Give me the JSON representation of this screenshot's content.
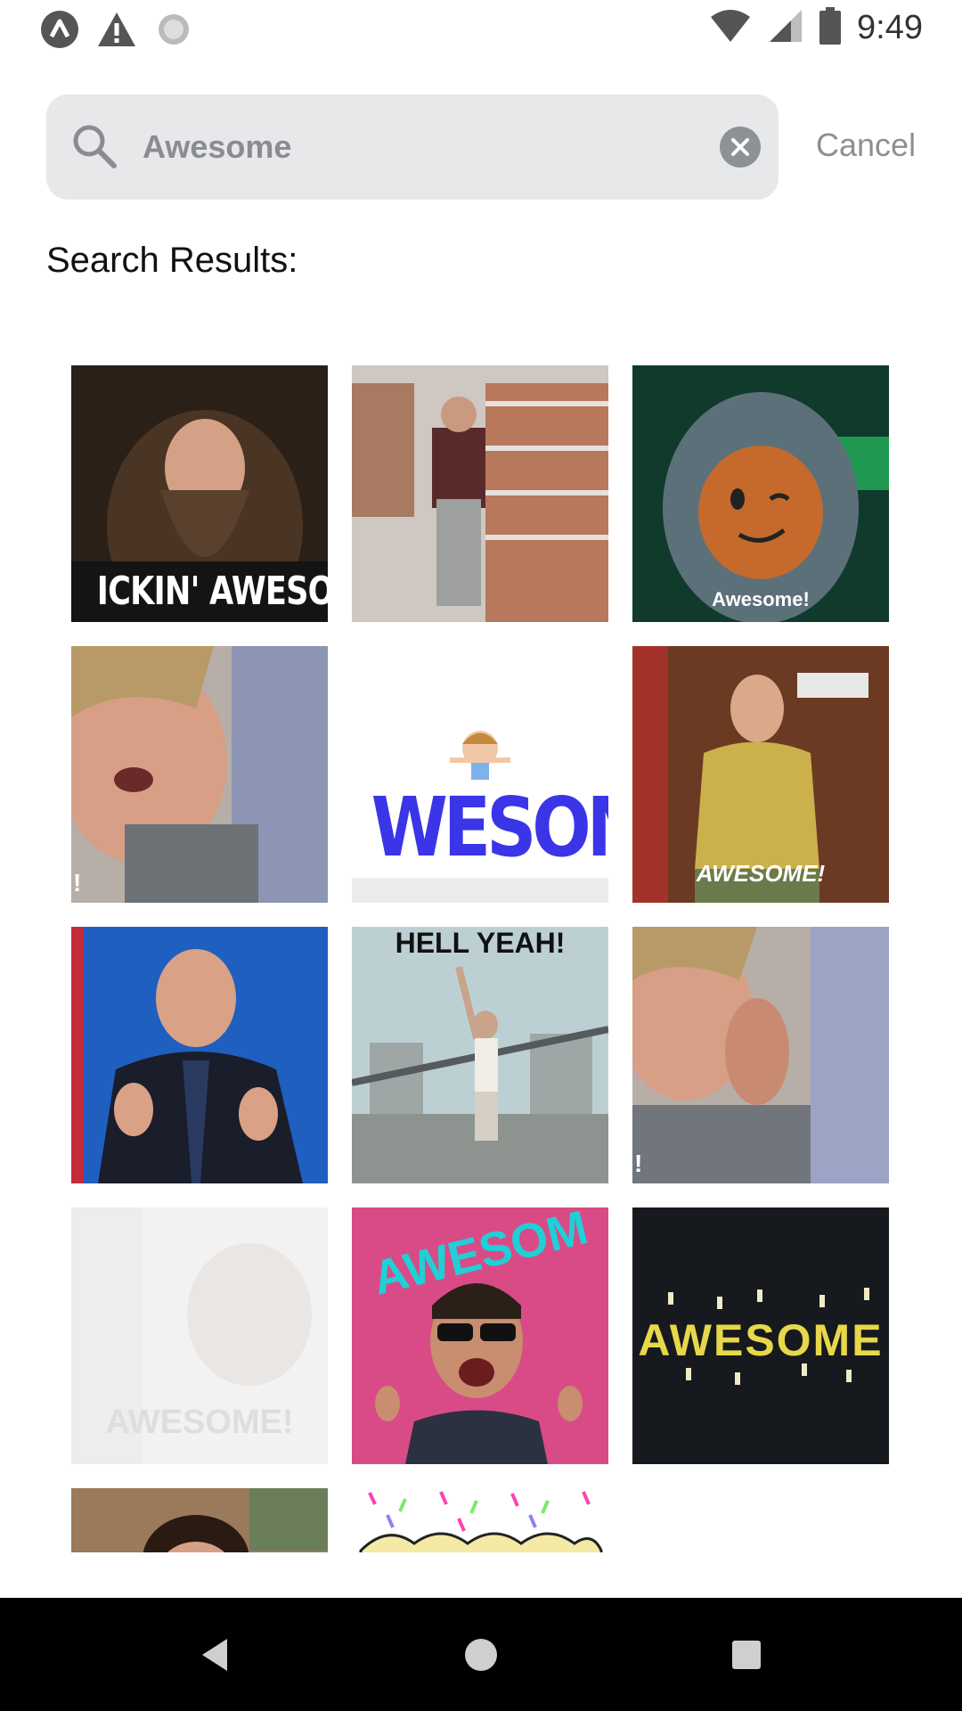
{
  "status_bar": {
    "time": "9:49",
    "left_icons": [
      "app-logo-icon",
      "warning-icon",
      "loading-icon"
    ],
    "right_icons": [
      "wifi-icon",
      "cell-signal-icon",
      "battery-icon"
    ]
  },
  "search": {
    "value": "Awesome",
    "cancel_label": "Cancel"
  },
  "results": {
    "title": "Search Results:",
    "gifs": [
      {
        "caption": "ICKIN' AWESOM"
      },
      {
        "caption": ""
      },
      {
        "caption": "Awesome!"
      },
      {
        "caption": "!"
      },
      {
        "caption": "WESOM"
      },
      {
        "caption": "AWESOME!"
      },
      {
        "caption": ""
      },
      {
        "caption": "HELL YEAH!"
      },
      {
        "caption": "!"
      },
      {
        "caption": "AWESOME!"
      },
      {
        "caption": "AWESOM"
      },
      {
        "caption": "AWESOME"
      },
      {
        "caption": ""
      },
      {
        "caption": ""
      }
    ]
  },
  "nav": {
    "buttons": [
      "back-icon",
      "home-icon",
      "recents-icon"
    ]
  },
  "colors": {
    "search_bg": "#e7e8ea",
    "muted_text": "#8e8f93",
    "navbar_bg": "#000000"
  }
}
